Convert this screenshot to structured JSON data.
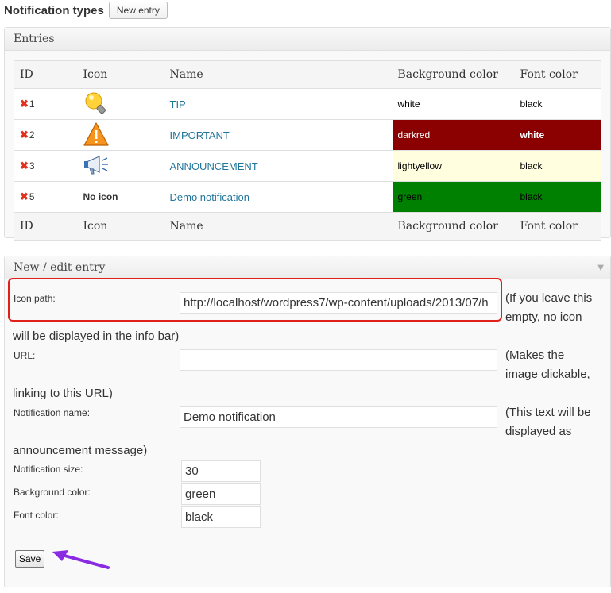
{
  "header": {
    "title": "Notification types",
    "new_entry_label": "New entry"
  },
  "entries_panel": {
    "title": "Entries",
    "columns": [
      "ID",
      "Icon",
      "Name",
      "Background color",
      "Font color"
    ],
    "rows": [
      {
        "id": "1",
        "icon": "lightbulb-icon",
        "icon_text": "",
        "name": "TIP",
        "bg": "white",
        "font": "black",
        "bg_color": "#ffffff",
        "font_color": "#000000"
      },
      {
        "id": "2",
        "icon": "warning-icon",
        "icon_text": "",
        "name": "IMPORTANT",
        "bg": "darkred",
        "font": "white",
        "bg_color": "#8b0000",
        "font_color": "#ffffff"
      },
      {
        "id": "3",
        "icon": "megaphone-icon",
        "icon_text": "",
        "name": "ANNOUNCEMENT",
        "bg": "lightyellow",
        "font": "black",
        "bg_color": "#ffffe0",
        "font_color": "#000000"
      },
      {
        "id": "5",
        "icon": "",
        "icon_text": "No icon",
        "name": "Demo notification",
        "bg": "green",
        "font": "black",
        "bg_color": "#008000",
        "font_color": "#000000"
      }
    ]
  },
  "edit_panel": {
    "title": "New / edit entry",
    "collapse_glyph": "▼",
    "icon_path": {
      "label": "Icon path:",
      "value": "http://localhost/wordpress7/wp-content/uploads/2013/07/h",
      "hint_a": "(If you leave this",
      "hint_b": "empty, no icon",
      "hint_c": "will be displayed in the info bar)"
    },
    "url": {
      "label": "URL:",
      "value": "",
      "hint_a": "(Makes the",
      "hint_b": "image clickable,",
      "hint_c": "linking to this URL)"
    },
    "notification_name": {
      "label": "Notification name:",
      "value": "Demo notification",
      "hint_a": "(This text will be",
      "hint_b": "displayed as",
      "hint_c": "announcement message)"
    },
    "notification_size": {
      "label": "Notification size:",
      "value": "30"
    },
    "background_color": {
      "label": "Background color:",
      "value": "green"
    },
    "font_color": {
      "label": "Font color:",
      "value": "black"
    },
    "save_label": "Save"
  },
  "annotations": {
    "highlight_color": "#e0201a",
    "arrow_color": "#8a2be2"
  }
}
